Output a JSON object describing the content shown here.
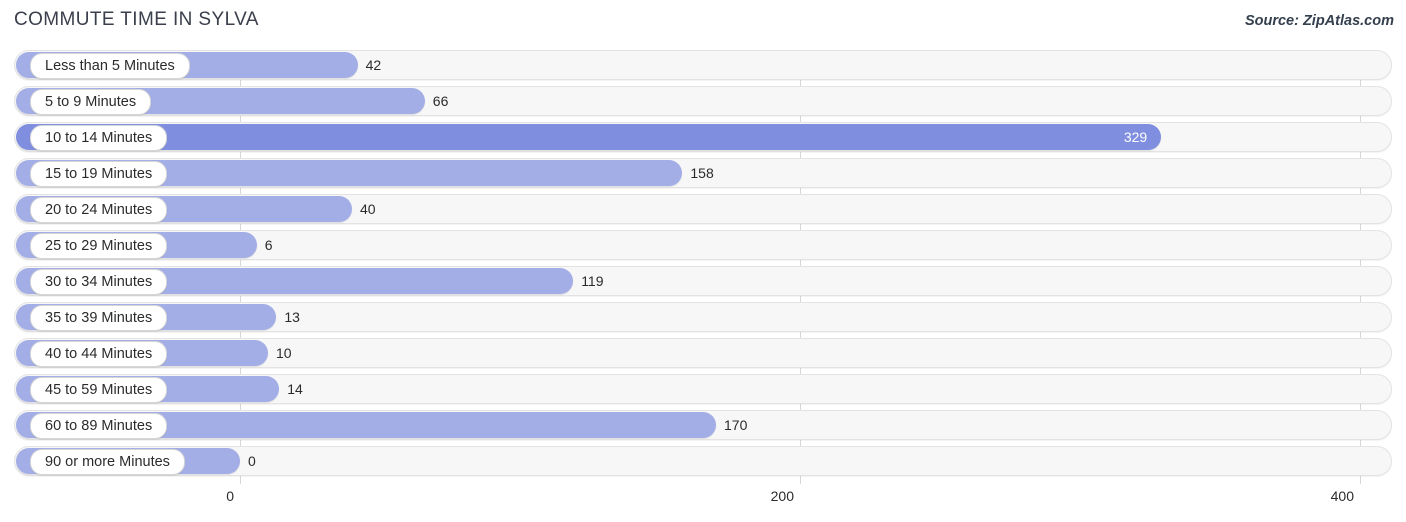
{
  "header": {
    "title": "COMMUTE TIME IN SYLVA",
    "source": "Source: ZipAtlas.com"
  },
  "colors": {
    "bar": "#a3aee7",
    "bar_highlight": "#7f8ede",
    "track": "#f7f7f7",
    "gridline": "#d8d8d8",
    "title_text": "#3a3f4b"
  },
  "chart_data": {
    "type": "bar",
    "orientation": "horizontal",
    "title": "COMMUTE TIME IN SYLVA",
    "xlabel": "",
    "ylabel": "",
    "source": "Source: ZipAtlas.com",
    "xlim": [
      0,
      400
    ],
    "xticks": [
      0,
      200,
      400
    ],
    "xtick_labels": [
      "0",
      "200",
      "400"
    ],
    "grid": true,
    "legend": false,
    "categories": [
      "Less than 5 Minutes",
      "5 to 9 Minutes",
      "10 to 14 Minutes",
      "15 to 19 Minutes",
      "20 to 24 Minutes",
      "25 to 29 Minutes",
      "30 to 34 Minutes",
      "35 to 39 Minutes",
      "40 to 44 Minutes",
      "45 to 59 Minutes",
      "60 to 89 Minutes",
      "90 or more Minutes"
    ],
    "values": [
      42,
      66,
      329,
      158,
      40,
      6,
      119,
      13,
      10,
      14,
      170,
      0
    ],
    "value_labels": [
      "42",
      "66",
      "329",
      "158",
      "40",
      "6",
      "119",
      "13",
      "10",
      "14",
      "170",
      "0"
    ],
    "highlight_index": 2
  }
}
